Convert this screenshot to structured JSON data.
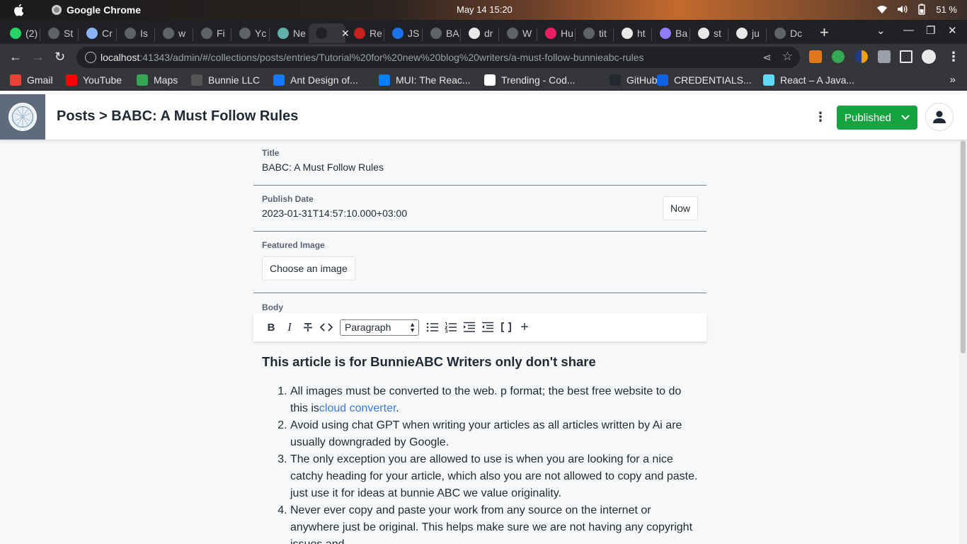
{
  "os": {
    "app_name": "Google Chrome",
    "clock": "May 14  15:20",
    "battery": "51 %"
  },
  "tabs": [
    {
      "label": "(2)"
    },
    {
      "label": "St"
    },
    {
      "label": "Cr"
    },
    {
      "label": "Is"
    },
    {
      "label": "w"
    },
    {
      "label": "Fi"
    },
    {
      "label": "Yc"
    },
    {
      "label": "Ne"
    },
    {
      "label": ""
    },
    {
      "label": "Re"
    },
    {
      "label": "JS"
    },
    {
      "label": "BA"
    },
    {
      "label": "dr"
    },
    {
      "label": "W"
    },
    {
      "label": "Hu"
    },
    {
      "label": "tit"
    },
    {
      "label": "ht"
    },
    {
      "label": "Ba"
    },
    {
      "label": "st"
    },
    {
      "label": "ju"
    },
    {
      "label": "Dc"
    }
  ],
  "address": {
    "host": "localhost",
    "rest": ":41343/admin/#/collections/posts/entries/Tutorial%20for%20new%20blog%20writers/a-must-follow-bunnieabc-rules"
  },
  "bookmarks": [
    {
      "label": "Gmail",
      "color": "#ea4335"
    },
    {
      "label": "YouTube",
      "color": "#ff0000"
    },
    {
      "label": "Maps",
      "color": "#34a853"
    },
    {
      "label": "Bunnie LLC",
      "color": "#555555"
    },
    {
      "label": "Ant Design of...",
      "color": "#1677ff"
    },
    {
      "label": "MUI: The Reac...",
      "color": "#007fff"
    },
    {
      "label": "Trending - Cod...",
      "color": "#ffffff"
    },
    {
      "label": "GitHub",
      "color": "#24292f"
    },
    {
      "label": "CREDENTIALS...",
      "color": "#0c63e4"
    },
    {
      "label": "React – A Java...",
      "color": "#61dafb"
    }
  ],
  "header": {
    "breadcrumb": "Posts > BABC: A Must Follow Rules",
    "status_button": "Published"
  },
  "form": {
    "title_label": "Title",
    "title_value": "BABC: A Must Follow Rules",
    "date_label": "Publish Date",
    "date_value": "2023-01-31T14:57:10.000+03:00",
    "now_button": "Now",
    "image_label": "Featured Image",
    "image_button": "Choose an image",
    "body_label": "Body",
    "block_type": "Paragraph"
  },
  "article": {
    "heading": "This article is for BunnieABC Writers only don't share",
    "items": [
      {
        "text": "All images must be converted to the web. p format; the best free website to do this is",
        "link": "cloud converter",
        "tail": "."
      },
      {
        "text": "Avoid using chat GPT when writing your articles as all articles written by Ai are usually downgraded by Google."
      },
      {
        "text": "The only exception you are allowed to use is when you are looking for a nice catchy heading for your article, which also you are not allowed to copy and paste. just use it for ideas at bunnie ABC we value originality."
      },
      {
        "text": "Never ever copy and paste your work from any source on the internet or anywhere just be original. This helps make sure we are not having any copyright issues and"
      }
    ]
  }
}
